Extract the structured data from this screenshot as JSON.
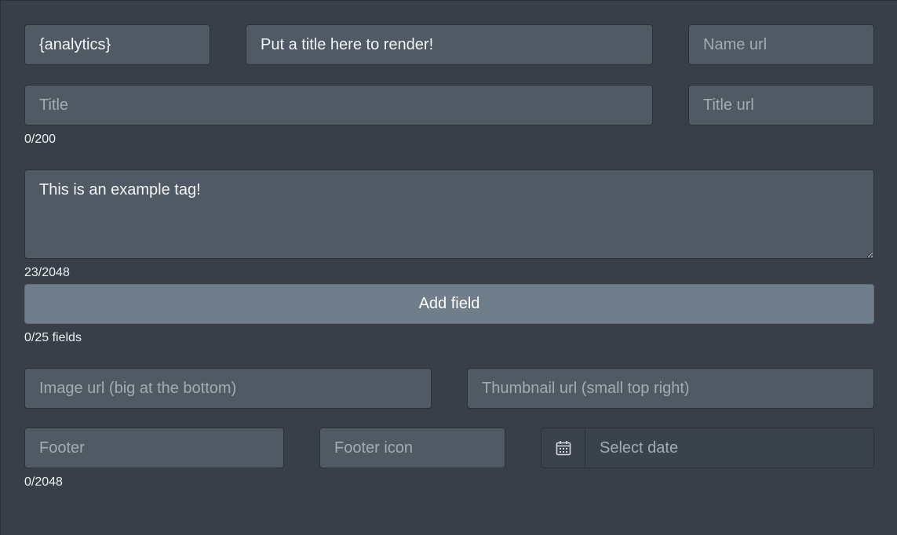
{
  "author": {
    "name_value": "{analytics}",
    "name_url_placeholder": "Name url"
  },
  "header": {
    "title_value": "Put a title here to render!"
  },
  "title": {
    "placeholder": "Title",
    "url_placeholder": "Title url",
    "counter": "0/200"
  },
  "description": {
    "value": "This is an example tag!",
    "counter": "23/2048"
  },
  "fields": {
    "add_label": "Add field",
    "counter": "0/25 fields"
  },
  "media": {
    "image_placeholder": "Image url (big at the bottom)",
    "thumbnail_placeholder": "Thumbnail url (small top right)"
  },
  "footer": {
    "text_placeholder": "Footer",
    "icon_placeholder": "Footer icon",
    "counter": "0/2048",
    "date_placeholder": "Select date",
    "date_icon": "calendar-icon"
  },
  "colors": {
    "background": "#383f48",
    "input_background": "#4f5a64",
    "button_background": "#6f7e8a"
  }
}
